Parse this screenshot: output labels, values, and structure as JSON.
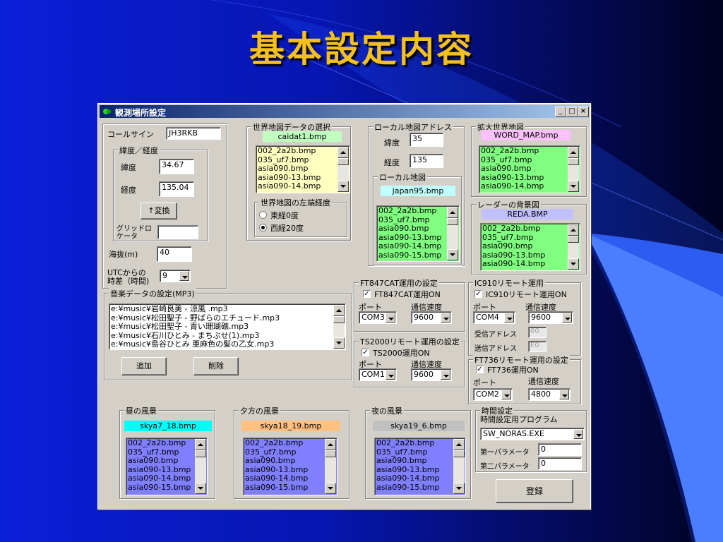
{
  "slide_title": "基本設定内容",
  "window": {
    "title": "観測場所設定",
    "buttons": {
      "minimize": "_",
      "maximize": "□",
      "close": "×"
    }
  },
  "colors": {
    "yellow_list": "#ffffc0",
    "green_list": "#80ff80",
    "purple_list": "#8080ff",
    "label_green": "#c0ffc0",
    "label_pink": "#ffc0ff",
    "label_cyan": "#c0ffff",
    "label_lav": "#c0c0ff",
    "label_brightcyan": "#00ffff",
    "label_orange": "#ffc080",
    "label_grey": "#c0c0c0"
  },
  "callsign": {
    "label": "コールサイン",
    "value": "JH3RKB"
  },
  "latlon": {
    "legend": "緯度／経度",
    "lat_label": "緯度",
    "lat_value": "34.67",
    "lon_label": "経度",
    "lon_value": "135.04",
    "convert_button": "↑変換",
    "grid_label1": "グリッドロ",
    "grid_label2": "ケータ",
    "grid_value": ""
  },
  "altitude": {
    "label": "海抜(m)",
    "value": "40"
  },
  "utc": {
    "label1": "UTCからの",
    "label2": "時差（時間)",
    "value": "9"
  },
  "world_map": {
    "legend": "世界地図データの選択",
    "file": "caidat1.bmp",
    "items": [
      "002_2a2b.bmp",
      "035_uf7.bmp",
      "asia090.bmp",
      "asia090-13.bmp",
      "asia090-14.bmp"
    ]
  },
  "left_lon": {
    "legend": "世界地図の左端経度",
    "opt1": "東経0度",
    "opt2": "西経20度"
  },
  "local_addr": {
    "legend": "ローカル地図アドレス",
    "lat_label": "緯度",
    "lat_value": "35",
    "lon_label": "経度",
    "lon_value": "135"
  },
  "local_map": {
    "legend": "ローカル地図",
    "file": "japan95.bmp",
    "items": [
      "002_2a2b.bmp",
      "035_uf7.bmp",
      "asia090.bmp",
      "asia090-13.bmp",
      "asia090-14.bmp",
      "asia090-15.bmp"
    ]
  },
  "ext_map": {
    "legend": "拡大世界地図",
    "file": "WORD_MAP.bmp",
    "items": [
      "002_2a2b.bmp",
      "035_uf7.bmp",
      "asia090.bmp",
      "asia090-13.bmp",
      "asia090-14.bmp"
    ]
  },
  "radar": {
    "legend": "レーダーの背景図",
    "file": "REDA.BMP",
    "items": [
      "002_2a2b.bmp",
      "035_uf7.bmp",
      "asia090.bmp",
      "asia090-13.bmp",
      "asia090-14.bmp"
    ]
  },
  "music": {
    "legend": "音楽データの設定(MP3)",
    "items": [
      "e:¥music¥岩崎良美 - 涼風 .mp3",
      "e:¥music¥松田聖子 - 野ばらのエチュード.mp3",
      "e:¥music¥松田聖子 - 青い珊瑚礁.mp3",
      "e:¥music¥石川ひとみ - まちぶせ(1).mp3",
      "e:¥music¥島谷ひとみ 亜麻色の髪の乙女.mp3"
    ],
    "add_button": "追加",
    "delete_button": "削除"
  },
  "ft847": {
    "legend": "FT847CAT運用の設定",
    "check_label": "FT847CAT運用ON",
    "port_label": "ポート",
    "port_value": "COM3",
    "speed_label": "通信速度",
    "speed_value": "9600"
  },
  "ic910": {
    "legend": "IC910リモート運用",
    "check_label": "IC910リモート運用ON",
    "port_label": "ポート",
    "port_value": "COM4",
    "speed_label": "通信速度",
    "speed_value": "9600",
    "recv_label": "受信アドレス",
    "recv_value": "60",
    "send_label": "送信アドレス",
    "send_value": "E0"
  },
  "ts2000": {
    "legend": "TS2000リモート運用の設定",
    "check_label": "TS2000運用ON",
    "port_label": "ポート",
    "port_value": "COM1",
    "speed_label": "通信速度",
    "speed_value": "9600"
  },
  "ft736": {
    "legend": "FT736リモート運用の設定",
    "check_label": "FT736運用ON",
    "port_label": "ポート",
    "port_value": "COM2",
    "speed_label": "通信速度",
    "speed_value": "4800"
  },
  "day_scene": {
    "legend": "昼の風景",
    "file": "skya7_18.bmp",
    "items": [
      "002_2a2b.bmp",
      "035_uf7.bmp",
      "asia090.bmp",
      "asia090-13.bmp",
      "asia090-14.bmp",
      "asia090-15.bmp"
    ]
  },
  "evening_scene": {
    "legend": "夕方の風景",
    "file": "skya18_19.bmp",
    "items": [
      "002_2a2b.bmp",
      "035_uf7.bmp",
      "asia090.bmp",
      "asia090-13.bmp",
      "asia090-14.bmp",
      "asia090-15.bmp"
    ]
  },
  "night_scene": {
    "legend": "夜の風景",
    "file": "skya19_6.bmp",
    "items": [
      "002_2a2b.bmp",
      "035_uf7.bmp",
      "asia090.bmp",
      "asia090-13.bmp",
      "asia090-14.bmp",
      "asia090-15.bmp"
    ]
  },
  "time_setting": {
    "legend1": "時間設定",
    "legend2": "時間設定用プログラム",
    "program_value": "SW_NORAS.EXE",
    "param1_label": "第一パラメータ",
    "param1_value": "0",
    "param2_label": "第二パラメータ",
    "param2_value": "0"
  },
  "register_button": "登録"
}
